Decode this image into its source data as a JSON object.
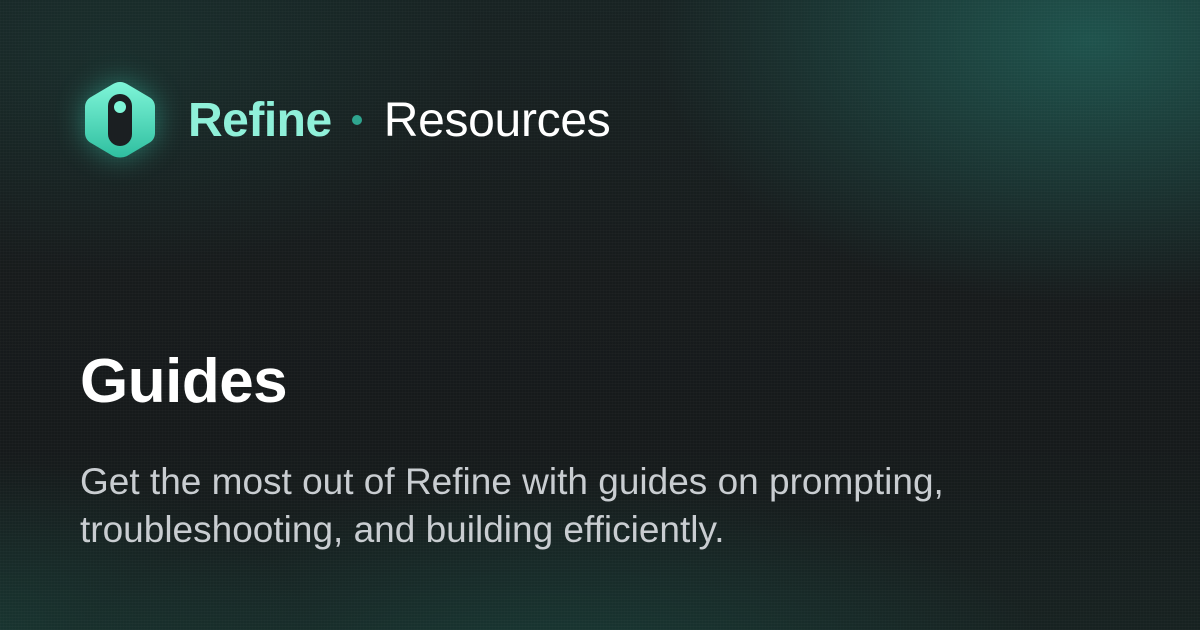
{
  "header": {
    "logo_icon": "refine-hexagon-logo-icon",
    "brand": "Refine",
    "section": "Resources"
  },
  "main": {
    "title": "Guides",
    "description": "Get the most out of Refine with guides on prompting, troubleshooting, and building efficiently."
  },
  "colors": {
    "accent": "#8ff0d9",
    "accent_dark": "#2fa58f",
    "background": "#17191b"
  }
}
